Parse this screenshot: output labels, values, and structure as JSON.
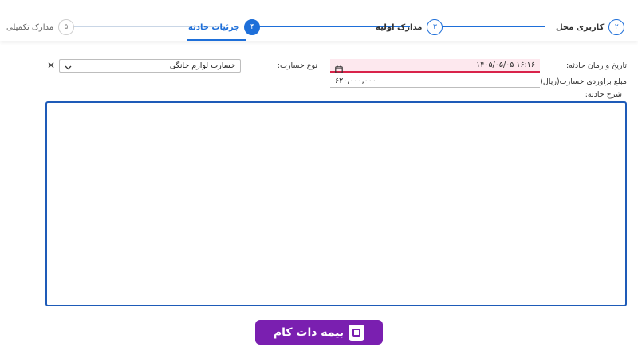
{
  "stepper": {
    "steps": [
      {
        "number": "۲",
        "label": "کاربری محل",
        "state": "done"
      },
      {
        "number": "۳",
        "label": "مدارک اولیه",
        "state": "done"
      },
      {
        "number": "۴",
        "label": "جزئیات حادثه",
        "state": "active"
      },
      {
        "number": "۵",
        "label": "مدارک تکمیلی",
        "state": "pending"
      }
    ]
  },
  "form": {
    "date_label": "تاریخ و زمان حادثه:",
    "date_value": "۱۴۰۵/۰۵/۰۵ ۱۶:۱۶",
    "loss_type_label": "نوع خسارت:",
    "loss_type_value": "خسارت لوازم خانگی",
    "amount_label": "مبلغ برآوردی خسارت(ریال):",
    "amount_value": "۶۲۰,۰۰۰,۰۰۰",
    "description_label": "شرح حادثه:",
    "description_value": "",
    "clear_symbol": "✕",
    "chevron_symbol": "⌄"
  },
  "logo": {
    "text": "بیمه دات کام"
  },
  "colors": {
    "primary": "#1e6fd9",
    "error": "#d9234a",
    "error_bg": "#fde8ee",
    "brand": "#7a1fb0"
  }
}
